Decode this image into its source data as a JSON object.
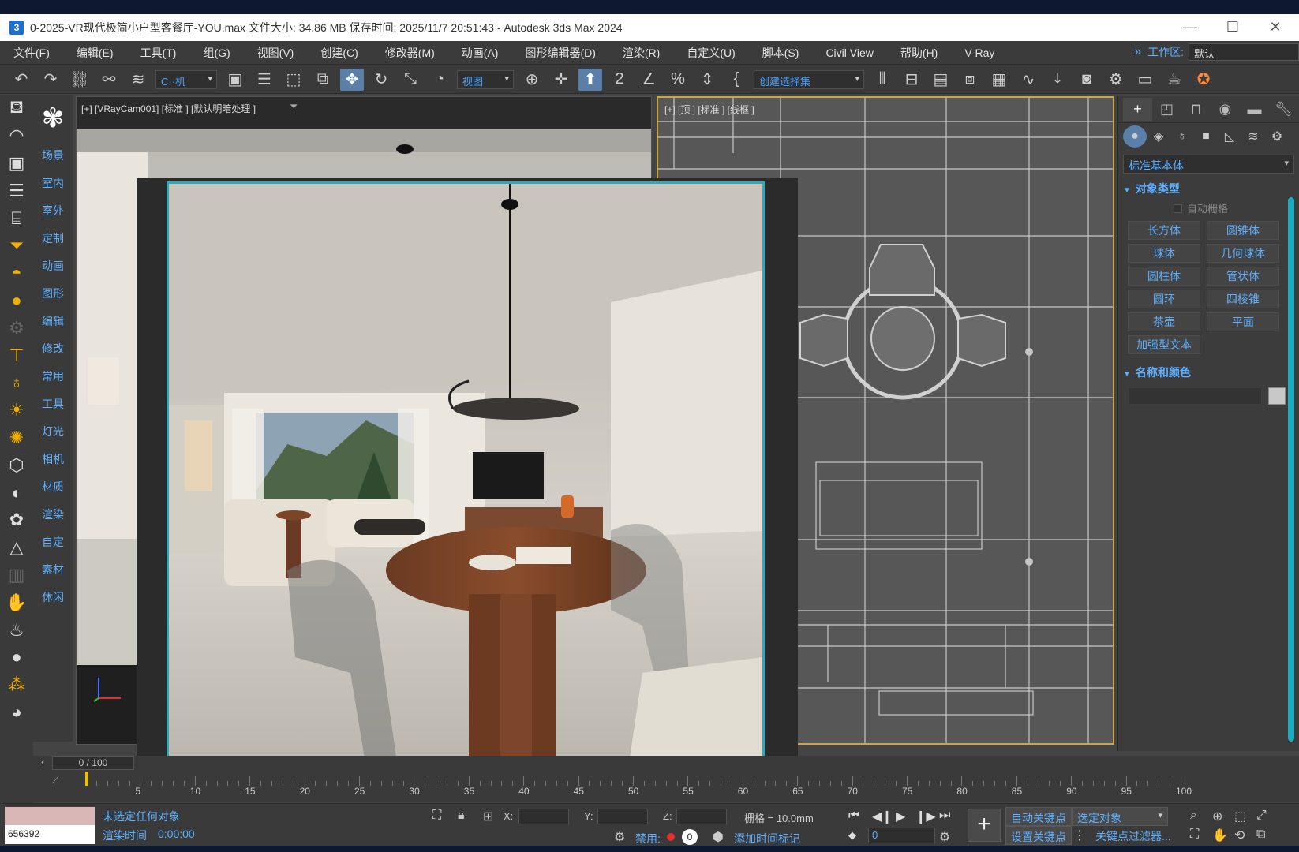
{
  "window": {
    "title": "0-2025-VR现代极简小户型客餐厅-YOU.max    文件大小: 34.86 MB  保存时间: 2025/11/7 20:51:43 - Autodesk 3ds Max 2024",
    "minimize": "—",
    "maximize": "☐",
    "close": "✕"
  },
  "menubar": {
    "items": [
      "文件(F)",
      "编辑(E)",
      "工具(T)",
      "组(G)",
      "视图(V)",
      "创建(C)",
      "修改器(M)",
      "动画(A)",
      "图形编辑器(D)",
      "渲染(R)",
      "自定义(U)",
      "脚本(S)",
      "Civil View",
      "帮助(H)",
      "V-Ray"
    ],
    "workspace_label": "工作区:",
    "workspace_value": "默认"
  },
  "toolbar": {
    "filter": "C··机",
    "refcoord": "视图",
    "selection_set": "创建选择集"
  },
  "scene_panel": {
    "items": [
      "场景",
      "室内",
      "室外",
      "定制",
      "动画",
      "图形",
      "编辑",
      "修改",
      "常用",
      "工具",
      "灯光",
      "相机",
      "材质",
      "渲染",
      "自定",
      "素材",
      "休闲"
    ]
  },
  "viewports": {
    "left_label": "[+] [VRayCam001] [标准 ] [默认明暗处理 ]",
    "right_label": "[+] [顶 ] [标准 ] [线框 ]"
  },
  "command_panel": {
    "dropdown": "标准基本体",
    "object_type_title": "对象类型",
    "autogrid": "自动栅格",
    "buttons": [
      "长方体",
      "圆锥体",
      "球体",
      "几何球体",
      "圆柱体",
      "管状体",
      "圆环",
      "四棱锥",
      "茶壶",
      "平面",
      "加强型文本"
    ],
    "name_color_title": "名称和颜色"
  },
  "timeline": {
    "frame_display": "0 / 100",
    "ticks": [
      "5",
      "10",
      "15",
      "20",
      "25",
      "30",
      "35",
      "40",
      "45",
      "50",
      "55",
      "60",
      "65",
      "70",
      "75",
      "80",
      "85",
      "90",
      "95",
      "100"
    ]
  },
  "status": {
    "maxscript_value": "656392",
    "selection": "未选定任何对象",
    "render_time_label": "渲染时间",
    "render_time_value": "0:00:00",
    "x_label": "X:",
    "y_label": "Y:",
    "z_label": "Z:",
    "grid": "栅格 = 10.0mm",
    "disable_label": "禁用:",
    "disable_count": "0",
    "add_time_tag": "添加时间标记",
    "auto_key": "自动关键点",
    "set_key": "设置关键点",
    "selected_object": "选定对象",
    "key_filter": "关键点过滤器...",
    "frame_field": "0"
  }
}
